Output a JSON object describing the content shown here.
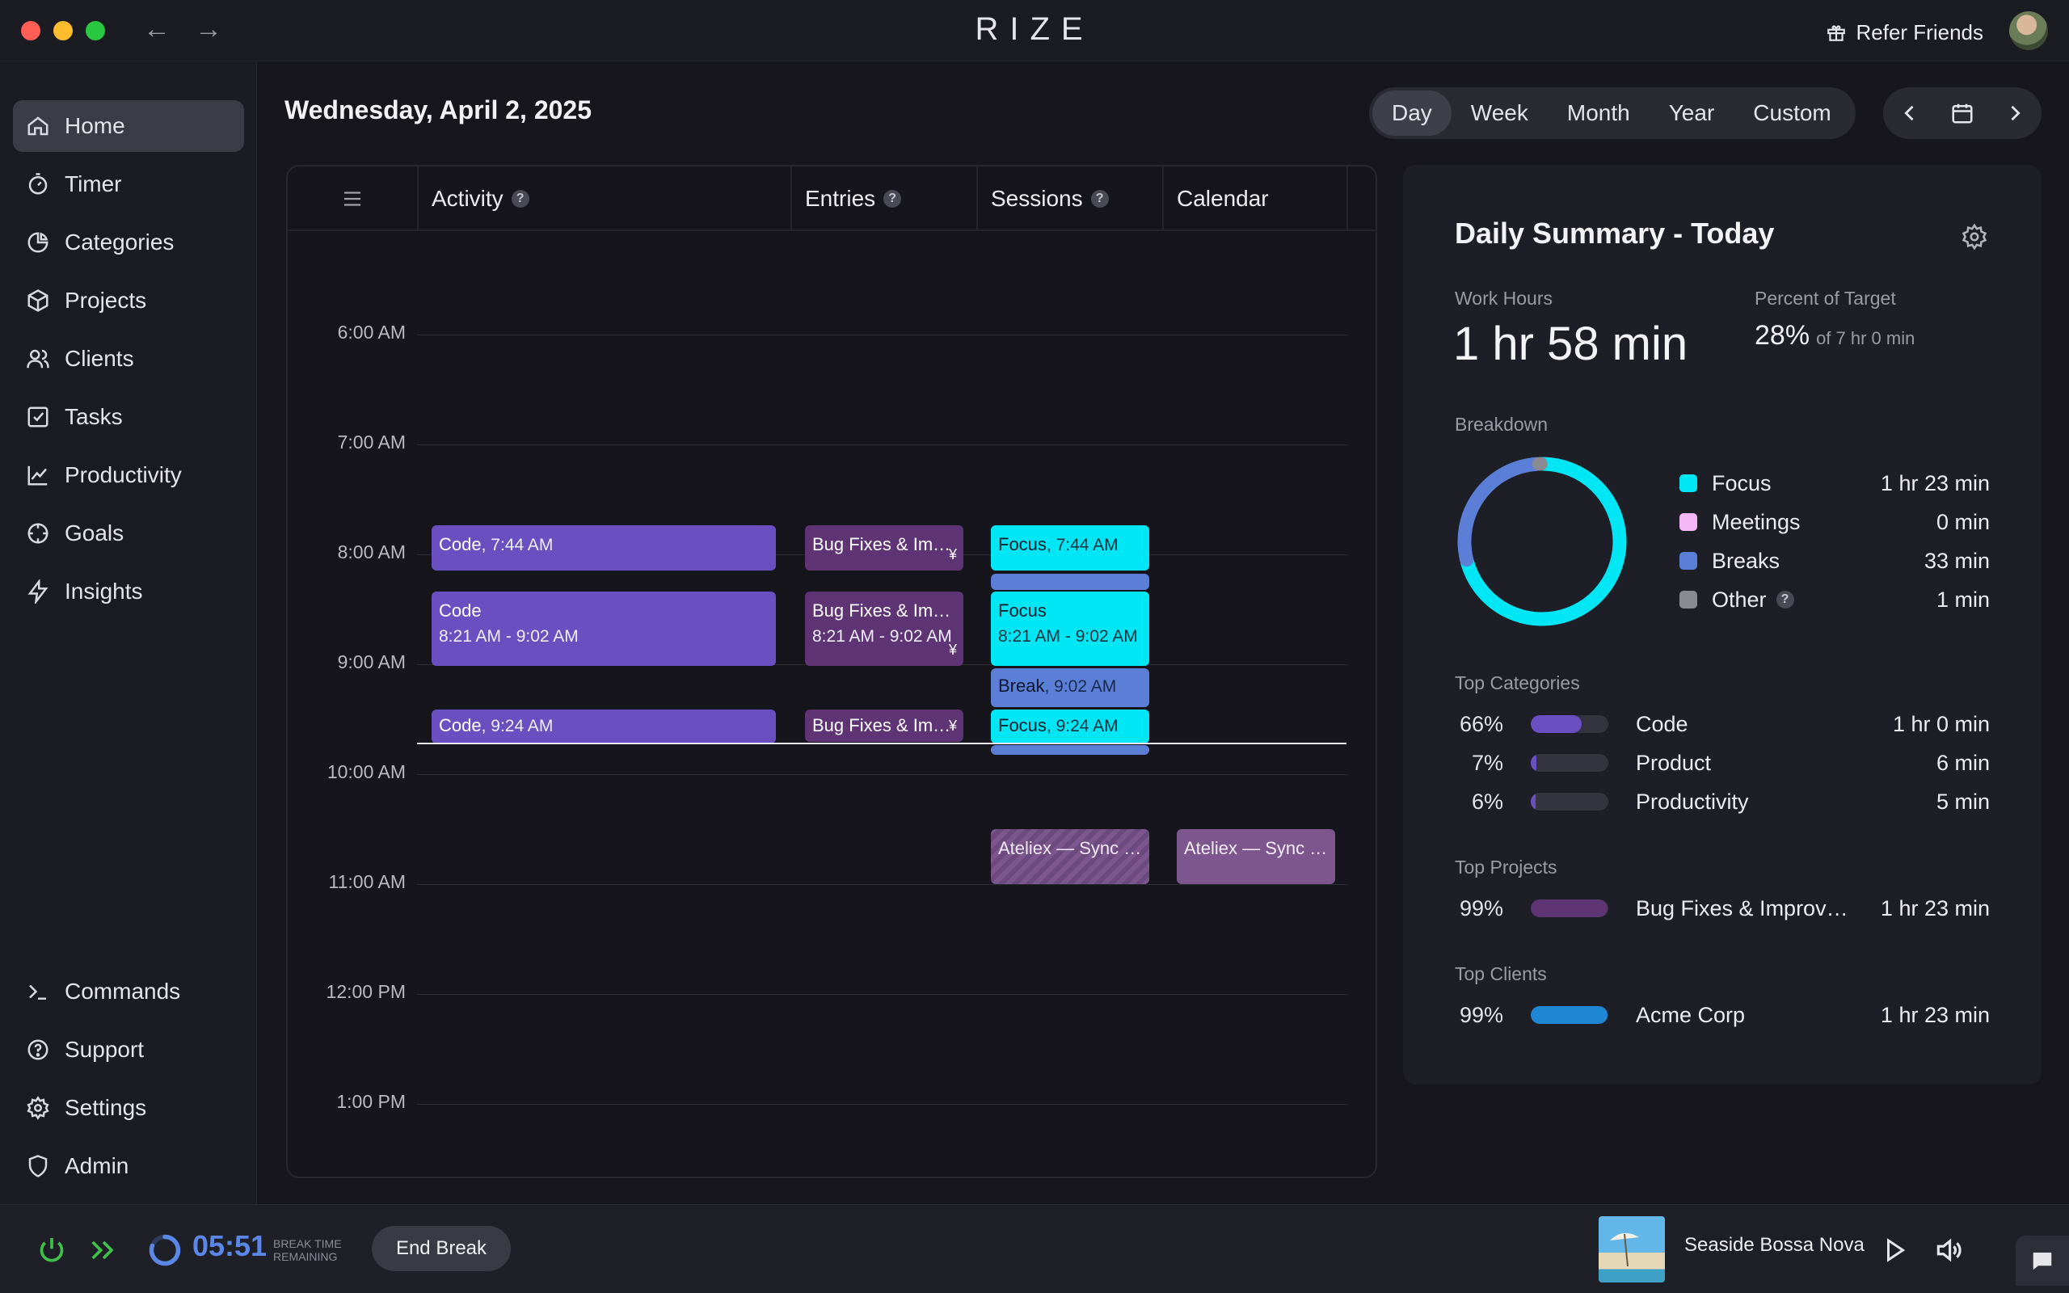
{
  "app": {
    "brand": "RIZE",
    "refer_label": "Refer Friends",
    "back_arrow": "←",
    "forward_arrow": "→"
  },
  "sidebar": {
    "top_items": [
      {
        "label": "Home",
        "icon": "home-icon",
        "active": true
      },
      {
        "label": "Timer",
        "icon": "timer-icon"
      },
      {
        "label": "Categories",
        "icon": "pie-icon"
      },
      {
        "label": "Projects",
        "icon": "cube-icon"
      },
      {
        "label": "Clients",
        "icon": "users-icon"
      },
      {
        "label": "Tasks",
        "icon": "checkbox-icon"
      },
      {
        "label": "Productivity",
        "icon": "chart-icon"
      },
      {
        "label": "Goals",
        "icon": "target-icon"
      },
      {
        "label": "Insights",
        "icon": "bolt-icon"
      }
    ],
    "bottom_items": [
      {
        "label": "Commands",
        "icon": "terminal-icon"
      },
      {
        "label": "Support",
        "icon": "help-icon"
      },
      {
        "label": "Settings",
        "icon": "gear-icon"
      },
      {
        "label": "Admin",
        "icon": "shield-icon"
      }
    ]
  },
  "header": {
    "date": "Wednesday, April 2, 2025",
    "range_tabs": [
      "Day",
      "Week",
      "Month",
      "Year",
      "Custom"
    ],
    "active_tab": "Day"
  },
  "timeline": {
    "columns": {
      "activity": "Activity",
      "entries": "Entries",
      "sessions": "Sessions",
      "calendar": "Calendar",
      "help": "?"
    },
    "hours": [
      "6:00 AM",
      "7:00 AM",
      "8:00 AM",
      "9:00 AM",
      "10:00 AM",
      "11:00 AM",
      "12:00 PM",
      "1:00 PM"
    ],
    "activity_blocks": [
      {
        "title": "Code",
        "time": ", 7:44 AM"
      },
      {
        "title": "Code",
        "time": "8:21 AM - 9:02 AM"
      },
      {
        "title": "Code",
        "time": ", 9:24 AM"
      }
    ],
    "entry_blocks": [
      {
        "title": "Bug Fixes & Im…",
        "time": "",
        "yen": "¥"
      },
      {
        "title": "Bug Fixes & Im…",
        "time": "8:21 AM - 9:02 AM",
        "yen": "¥"
      },
      {
        "title": "Bug Fixes & Im…",
        "time": "",
        "yen": "¥"
      }
    ],
    "session_blocks": [
      {
        "title": "Focus",
        "time": ", 7:44 AM"
      },
      {
        "title": "Focus",
        "time": "8:21 AM - 9:02 AM"
      },
      {
        "title": "Break",
        "time": ", 9:02 AM"
      },
      {
        "title": "Focus",
        "time": ", 9:24 AM"
      },
      {
        "title": "Ateliex — Sync …",
        "time": ""
      }
    ],
    "calendar_blocks": [
      {
        "title": "Ateliex — Sync …"
      }
    ]
  },
  "summary": {
    "title": "Daily Summary - Today",
    "work_hours_label": "Work Hours",
    "work_hours": "1 hr 58 min",
    "target_label": "Percent of Target",
    "target_pct": "28%",
    "target_of": "of 7 hr 0 min",
    "breakdown_label": "Breakdown",
    "breakdown": [
      {
        "name": "Focus",
        "value": "1 hr 23 min",
        "color": "#00e6f5",
        "minutes": 83
      },
      {
        "name": "Meetings",
        "value": "0 min",
        "color": "#f4b6f5",
        "minutes": 0
      },
      {
        "name": "Breaks",
        "value": "33 min",
        "color": "#5b7fd6",
        "minutes": 33
      },
      {
        "name": "Other",
        "value": "1 min",
        "color": "#8a8a92",
        "minutes": 1,
        "help": "?"
      }
    ],
    "top_categories_label": "Top Categories",
    "top_categories": [
      {
        "pct": "66%",
        "fraction": 0.66,
        "name": "Code",
        "value": "1 hr 0 min",
        "color": "#6a4fc1"
      },
      {
        "pct": "7%",
        "fraction": 0.07,
        "name": "Product",
        "value": "6 min",
        "color": "#6a4fc1"
      },
      {
        "pct": "6%",
        "fraction": 0.06,
        "name": "Productivity",
        "value": "5 min",
        "color": "#6a4fc1"
      }
    ],
    "top_projects_label": "Top Projects",
    "top_projects": [
      {
        "pct": "99%",
        "fraction": 0.99,
        "name": "Bug Fixes & Improv…",
        "value": "1 hr 23 min",
        "color": "#5e3474"
      }
    ],
    "top_clients_label": "Top Clients",
    "top_clients": [
      {
        "pct": "99%",
        "fraction": 0.99,
        "name": "Acme Corp",
        "value": "1 hr 23 min",
        "color": "#1e88d4"
      }
    ]
  },
  "bottom": {
    "timer": "05:51",
    "timer_sub_1": "BREAK TIME",
    "timer_sub_2": "REMAINING",
    "end_break": "End Break",
    "song": "Seaside Bossa Nova"
  }
}
